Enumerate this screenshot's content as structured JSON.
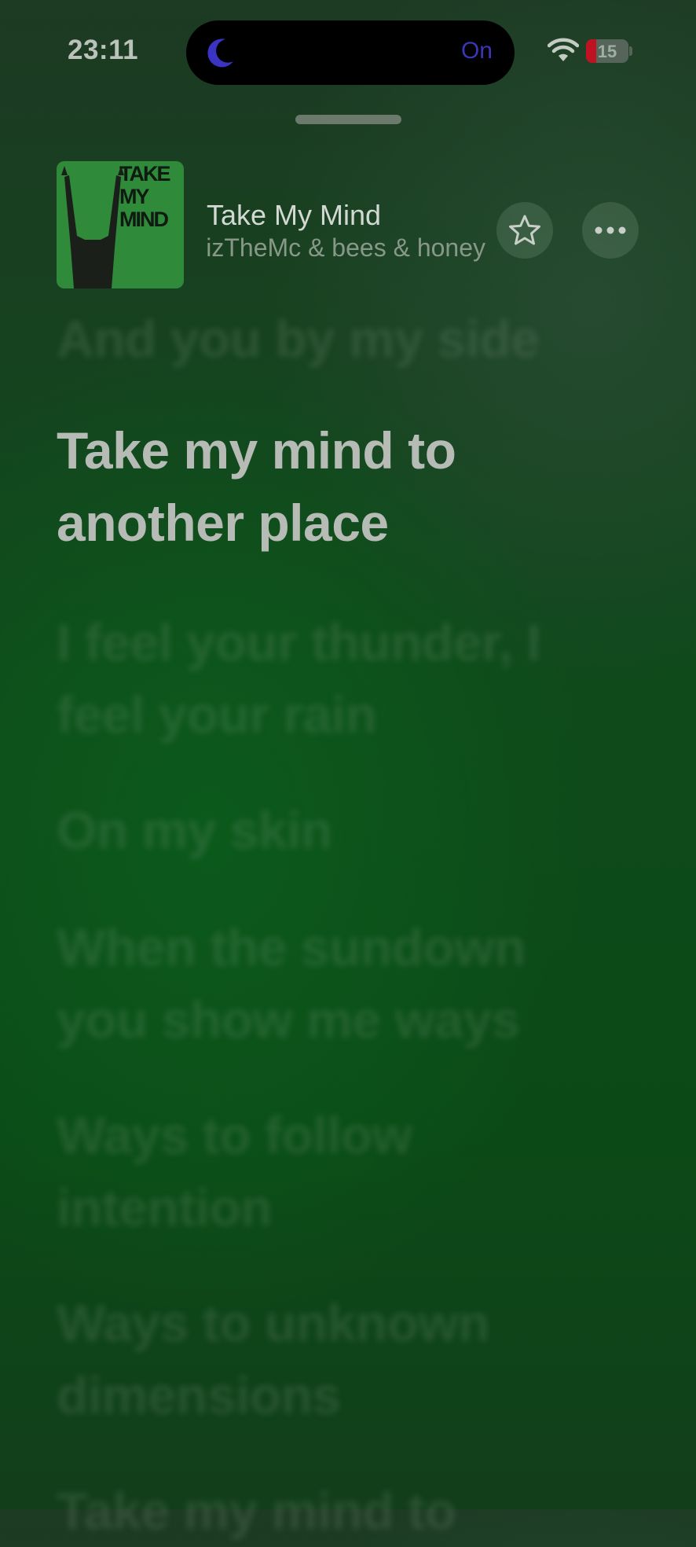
{
  "status_bar": {
    "time": "23:11",
    "focus_mode_state": "On",
    "battery_level": "15",
    "icons": [
      "moon-icon",
      "wifi-icon",
      "battery-icon"
    ]
  },
  "now_playing": {
    "album_art_text": "TAKE MY MIND",
    "title": "Take My Mind",
    "artist": "izTheMc & bees & honey"
  },
  "lyrics": [
    {
      "text": "And you by my side",
      "active": false
    },
    {
      "text": "Take my mind to another place",
      "active": true
    },
    {
      "text": "I feel your thunder, I feel your rain",
      "active": false
    },
    {
      "text": "On my skin",
      "active": false
    },
    {
      "text": "When the sundown you show me ways",
      "active": false
    },
    {
      "text": "Ways to follow intention",
      "active": false
    },
    {
      "text": "Ways to unknown dimensions",
      "active": false
    },
    {
      "text": "Take my mind to",
      "active": false
    }
  ],
  "colors": {
    "background": "#0b4a17",
    "active_lyric": "#b7bbb6",
    "focus_accent": "#3c35b8",
    "battery_low": "#c01220"
  }
}
